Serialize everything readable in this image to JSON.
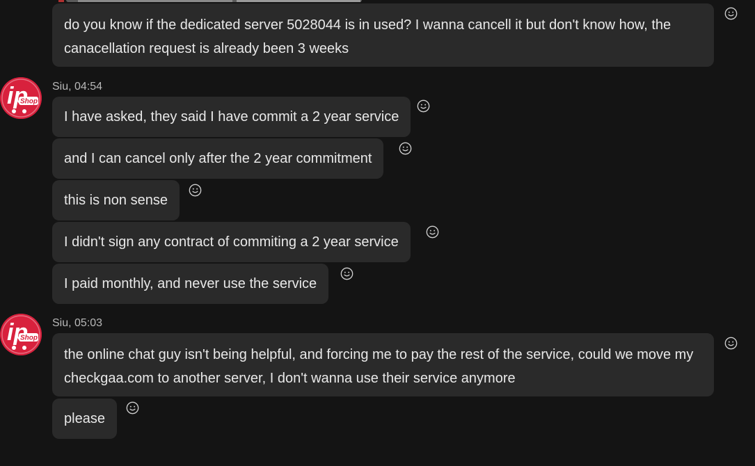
{
  "conversation": {
    "messages": [
      {
        "text": "do you know if the dedicated server 5028044 is in used? I wanna cancell it but don't know how, the canacellation request is already been 3 weeks"
      }
    ],
    "groups": [
      {
        "sender": "Siu",
        "time": "04:54",
        "meta": "Siu, 04:54",
        "messages": [
          {
            "text": "I have asked, they said I have commit a 2 year service"
          },
          {
            "text": "and I can cancel only after the 2 year commitment"
          },
          {
            "text": "this is non sense"
          },
          {
            "text": "I didn't sign any contract of commiting a 2 year service"
          },
          {
            "text": "I paid monthly, and never use the service"
          }
        ]
      },
      {
        "sender": "Siu",
        "time": "05:03",
        "meta": "Siu, 05:03",
        "messages": [
          {
            "text": "the online chat guy isn't being helpful, and forcing me to pay the rest of the service, could we move my checkgaa.com to another server, I don't wanna use their service anymore"
          },
          {
            "text": "please"
          }
        ]
      }
    ]
  },
  "avatar": {
    "logo_text": "ip",
    "logo_sub": "Shop",
    "brand_color": "#d8213d"
  },
  "icons": {
    "reaction": "smiley-reaction-icon"
  }
}
